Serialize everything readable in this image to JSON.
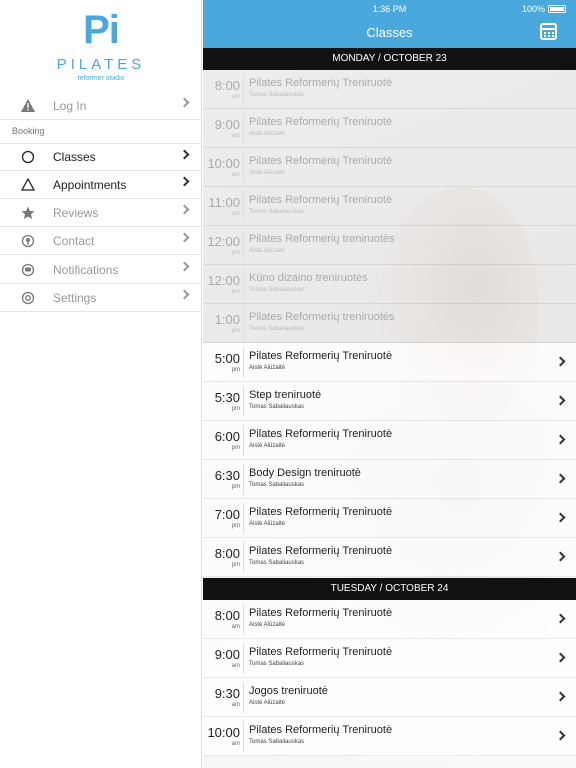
{
  "status": {
    "time": "1:36 PM",
    "battery": "100%"
  },
  "header": {
    "title": "Classes"
  },
  "sidebar": {
    "logo_mark": "Pi",
    "logo_name": "PILATES",
    "logo_sub": "reformer studio",
    "login_label": "Log In",
    "section_label": "Booking",
    "items": [
      {
        "label": "Classes"
      },
      {
        "label": "Appointments"
      },
      {
        "label": "Reviews"
      },
      {
        "label": "Contact"
      },
      {
        "label": "Notifications"
      },
      {
        "label": "Settings"
      }
    ]
  },
  "days": [
    {
      "label": "MONDAY / OCTOBER 23",
      "classes": [
        {
          "time": "8:00",
          "ampm": "am",
          "name": "Pilates Reformerių Treniruotė",
          "instructor": "Tomas Sabaliauskas",
          "past": true
        },
        {
          "time": "9:00",
          "ampm": "am",
          "name": "Pilates Reformerių Treniruotė",
          "instructor": "Aistė Alūzaitė",
          "past": true
        },
        {
          "time": "10:00",
          "ampm": "am",
          "name": "Pilates Reformerių Treniruotė",
          "instructor": "Aistė Alūzaitė",
          "past": true
        },
        {
          "time": "11:00",
          "ampm": "am",
          "name": "Pilates Reformerių Treniruotė",
          "instructor": "Tomas Sabaliauskas",
          "past": true
        },
        {
          "time": "12:00",
          "ampm": "pm",
          "name": "Pilates Reformerių treniruotės",
          "instructor": "Aistė Alūzaitė",
          "past": true
        },
        {
          "time": "12:00",
          "ampm": "pm",
          "name": "Kūno dizaino treniruotės",
          "instructor": "Tomas Sabaliauskas",
          "past": true
        },
        {
          "time": "1:00",
          "ampm": "pm",
          "name": "Pilates Reformerių treniruotės",
          "instructor": "Tomas Sabaliauskas",
          "past": true
        },
        {
          "time": "5:00",
          "ampm": "pm",
          "name": "Pilates Reformerių Treniruotė",
          "instructor": "Aistė Alūzaitė",
          "past": false
        },
        {
          "time": "5:30",
          "ampm": "pm",
          "name": "Step treniruotė",
          "instructor": "Tomas Sabaliauskas",
          "past": false
        },
        {
          "time": "6:00",
          "ampm": "pm",
          "name": "Pilates Reformerių Treniruotė",
          "instructor": "Aistė Alūzaitė",
          "past": false
        },
        {
          "time": "6:30",
          "ampm": "pm",
          "name": "Body Design treniruotė",
          "instructor": "Tomas Sabaliauskas",
          "past": false
        },
        {
          "time": "7:00",
          "ampm": "pm",
          "name": "Pilates Reformerių Treniruotė",
          "instructor": "Aistė Alūzaitė",
          "past": false
        },
        {
          "time": "8:00",
          "ampm": "pm",
          "name": "Pilates Reformerių Treniruotė",
          "instructor": "Tomas Sabaliauskas",
          "past": false
        }
      ]
    },
    {
      "label": "TUESDAY / OCTOBER 24",
      "classes": [
        {
          "time": "8:00",
          "ampm": "am",
          "name": "Pilates Reformerių Treniruotė",
          "instructor": "Aistė Alūzaitė",
          "past": false
        },
        {
          "time": "9:00",
          "ampm": "am",
          "name": "Pilates Reformerių Treniruotė",
          "instructor": "Tomas Sabaliauskas",
          "past": false
        },
        {
          "time": "9:30",
          "ampm": "am",
          "name": "Jogos treniruotė",
          "instructor": "Aistė Alūzaitė",
          "past": false
        },
        {
          "time": "10:00",
          "ampm": "am",
          "name": "Pilates Reformerių Treniruotė",
          "instructor": "Tomas Sabaliauskas",
          "past": false
        }
      ]
    }
  ],
  "colors": {
    "accent": "#4aa8dc",
    "header_bar": "#111111"
  }
}
